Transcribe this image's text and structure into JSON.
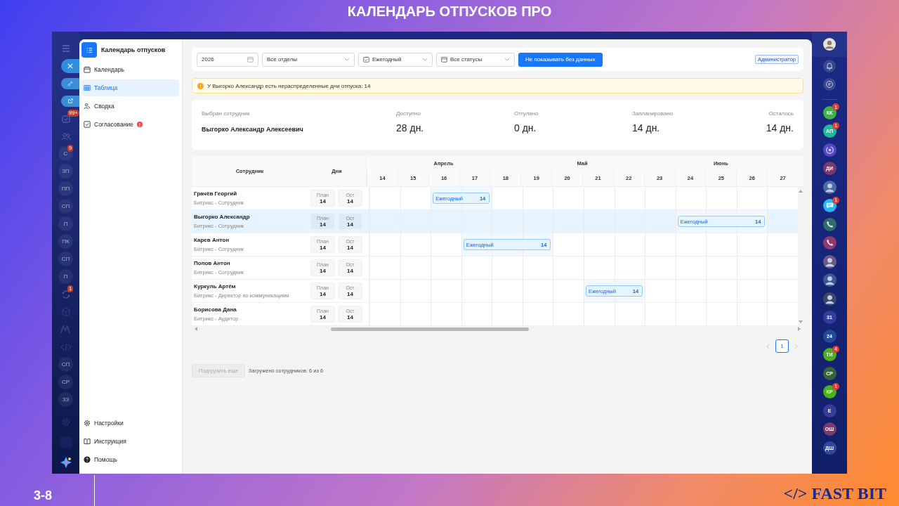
{
  "slide": {
    "title": "КАЛЕНДАРЬ ОТПУСКОВ ПРО",
    "page": "3-8",
    "brand": "</> FAST BIT"
  },
  "left_rail": {
    "items": [
      {
        "kind": "menu"
      },
      {
        "kind": "close"
      },
      {
        "kind": "link"
      },
      {
        "kind": "external"
      },
      {
        "kind": "tasks",
        "badge": "99+"
      },
      {
        "kind": "people"
      },
      {
        "kind": "initials",
        "text": "С",
        "badge": "9"
      },
      {
        "kind": "initials",
        "text": "ЗП"
      },
      {
        "kind": "initials",
        "text": "ПП"
      },
      {
        "kind": "initials",
        "text": "СП"
      },
      {
        "kind": "initials",
        "text": "П"
      },
      {
        "kind": "initials",
        "text": "ПК"
      },
      {
        "kind": "initials",
        "text": "СП"
      },
      {
        "kind": "initials",
        "text": "П"
      },
      {
        "kind": "sync",
        "badge": "1"
      },
      {
        "kind": "cube"
      },
      {
        "kind": "m"
      },
      {
        "kind": "code"
      },
      {
        "kind": "initials",
        "text": "СП"
      },
      {
        "kind": "initials",
        "text": "СР"
      },
      {
        "kind": "initials",
        "text": "ЗЗ"
      }
    ],
    "bottom_items": [
      {
        "kind": "gear"
      },
      {
        "kind": "square"
      },
      {
        "kind": "logo"
      }
    ]
  },
  "right_rail": {
    "items": [
      {
        "kind": "initials",
        "text": "КК",
        "color": "#3cb44a",
        "badge": "1"
      },
      {
        "kind": "initials",
        "text": "АП",
        "color": "#1fb89a",
        "badge": "1"
      },
      {
        "kind": "swirl",
        "color": "#5546c8"
      },
      {
        "kind": "initials",
        "text": "ДИ",
        "color": "#7a3a6e"
      },
      {
        "kind": "photo",
        "color": "#4a6aa8"
      },
      {
        "kind": "chat",
        "color": "#29b6f6",
        "badge": "1"
      },
      {
        "kind": "phone",
        "color": "#2e6e6a"
      },
      {
        "kind": "phone",
        "color": "#8e3a70"
      },
      {
        "kind": "photo",
        "color": "#6a5a8a"
      },
      {
        "kind": "photo",
        "color": "#3a5a9a"
      },
      {
        "kind": "photo",
        "color": "#3a4a6a"
      },
      {
        "kind": "initials",
        "text": "31",
        "color": "#353c9a"
      },
      {
        "kind": "initials",
        "text": "24",
        "color": "#24489a"
      },
      {
        "kind": "initials",
        "text": "ТИ",
        "color": "#4caf20",
        "badge": "4"
      },
      {
        "kind": "initials",
        "text": "СР",
        "color": "#35643a"
      },
      {
        "kind": "initials",
        "text": "КР",
        "color": "#4caf20",
        "badge": "1"
      },
      {
        "kind": "initials",
        "text": "Е",
        "color": "#353c9a"
      },
      {
        "kind": "initials",
        "text": "ОШ",
        "color": "#7a3a6e"
      },
      {
        "kind": "initials",
        "text": "ДШ",
        "color": "#34489a"
      }
    ]
  },
  "sidebar": {
    "title": "Календарь отпусков",
    "items": [
      {
        "label": "Календарь",
        "selected": false
      },
      {
        "label": "Таблица",
        "selected": true
      },
      {
        "label": "Сводка",
        "selected": false
      },
      {
        "label": "Согласование",
        "selected": false,
        "badge": "!"
      }
    ],
    "bottom_items": [
      {
        "label": "Настройки"
      },
      {
        "label": "Инструкция"
      },
      {
        "label": "Помощь"
      }
    ]
  },
  "toolbar": {
    "year": "2026",
    "department": "Все отделы",
    "type": "Ежегодный",
    "status": "Все статусы",
    "button": "Не показывать без данных",
    "role": "Администратор"
  },
  "alert": {
    "text": "У Выгорко Александр есть нераспределенные дни отпуска: 14"
  },
  "summary": {
    "employee_label": "Выбран сотрудник",
    "employee_name": "Выгорко Александр Алексеевич",
    "items": [
      {
        "label": "Доступно",
        "value": "28 дн."
      },
      {
        "label": "Отгуляно",
        "value": "0 дн."
      },
      {
        "label": "Запланировано",
        "value": "14 дн."
      },
      {
        "label": "Осталось",
        "value": "14 дн."
      }
    ]
  },
  "table": {
    "columns": [
      "Сотрудник",
      "Дни"
    ],
    "months": [
      {
        "label": "Апрель",
        "days": [
          "14",
          "15",
          "16",
          "17",
          "18"
        ]
      },
      {
        "label": "Май",
        "days": [
          "19",
          "20",
          "21",
          "22"
        ]
      },
      {
        "label": "Июнь",
        "days": [
          "23",
          "24",
          "25",
          "26",
          "27"
        ]
      }
    ],
    "rows": [
      {
        "name": "Грачёв Георгий",
        "role": "Битрикс - Сотрудник",
        "plan_label": "План",
        "plan": "14",
        "rest_label": "Ост",
        "rest": "14",
        "selected": false,
        "vacation": {
          "label": "Ежегодный",
          "count": "14",
          "covered": [
            false,
            false,
            true,
            true,
            false,
            false,
            false,
            false,
            false,
            false,
            false,
            false,
            false,
            false
          ]
        }
      },
      {
        "name": "Выгорко Александр",
        "role": "Битрикс - Сотрудник",
        "plan_label": "План",
        "plan": "14",
        "rest_label": "Ост",
        "rest": "14",
        "selected": true,
        "vacation": {
          "label": "Ежегодный",
          "count": "14",
          "covered": [
            false,
            false,
            false,
            false,
            false,
            false,
            false,
            false,
            false,
            false,
            true,
            true,
            true,
            false
          ]
        }
      },
      {
        "name": "Карев Антон",
        "role": "Битрикс - Сотрудник",
        "plan_label": "План",
        "plan": "14",
        "rest_label": "Ост",
        "rest": "14",
        "selected": false,
        "vacation": {
          "label": "Ежегодный",
          "count": "14",
          "covered": [
            false,
            false,
            false,
            true,
            true,
            true,
            false,
            false,
            false,
            false,
            false,
            false,
            false,
            false
          ]
        }
      },
      {
        "name": "Попов Антон",
        "role": "Битрикс - Сотрудник",
        "plan_label": "План",
        "plan": "14",
        "rest_label": "Ост",
        "rest": "14",
        "selected": false
      },
      {
        "name": "Куркуль Артём",
        "role": "Битрикс - Директор по коммуникациям",
        "plan_label": "План",
        "plan": "14",
        "rest_label": "Ост",
        "rest": "14",
        "selected": false,
        "vacation": {
          "label": "Ежегодный",
          "count": "14",
          "covered": [
            false,
            false,
            false,
            false,
            false,
            false,
            false,
            true,
            true,
            false,
            false,
            false,
            false,
            false
          ]
        }
      },
      {
        "name": "Борисова Дана",
        "role": "Битрикс - Аудитор",
        "plan_label": "План",
        "plan": "14",
        "rest_label": "Ост",
        "rest": "14",
        "selected": false
      }
    ]
  },
  "pagination": {
    "pages": [
      {
        "label": "1",
        "selected": true
      }
    ]
  },
  "footer": {
    "load_more": {
      "label": "Подгрузить еще",
      "disabled": true
    },
    "loaded_text": "Загружено сотрудников: 6 из 6"
  }
}
